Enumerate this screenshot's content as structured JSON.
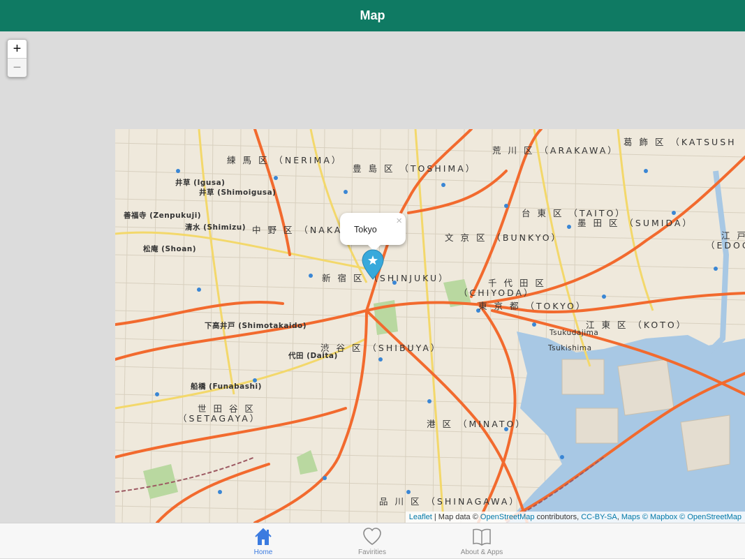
{
  "header": {
    "title": "Map"
  },
  "zoom": {
    "in_label": "+",
    "out_label": "−"
  },
  "map": {
    "popup_text": "Tokyo",
    "popup_close": "×",
    "labels": {
      "nerima": "練 馬 区 （NERIMA）",
      "toshima": "豊 島 区 （TOSHIMA）",
      "arakawa": "荒 川 区 （ARAKAWA）",
      "katsushika": "葛 飾 区 （KATSUSH",
      "igusa": "井草 (Igusa)",
      "shimoigusa": "井草 (Shimoigusa)",
      "zenpukuji": "善福寺 (Zenpukuji)",
      "shimizu": "清水 (Shimizu)",
      "nakano": "中 野 区 （NAKA",
      "taito": "台 東 区 （TAITO）",
      "sumida": "墨 田 区 （SUMIDA）",
      "edo": "江 戸",
      "edo2": "（EDOG",
      "bunkyo": "文 京 区 （BUNKYO）",
      "shoan": "松庵 (Shoan)",
      "shinjuku": "新 宿 区 （SHINJUKU）",
      "chiyoda_jp": "千 代 田 区",
      "chiyoda": "（CHIYODA）",
      "tokyo_ku": "東 京 都 （TOKYO）",
      "shimotakaido": "下高井戸 (Shimotakaido)",
      "koto": "江 東 区 （KOTO）",
      "tsukudajima": "Tsukudajima",
      "tsukishima": "Tsukishima",
      "shibuya": "渋 谷 区 （SHIBUYA）",
      "daita": "代田 (Daita)",
      "funabashi": "船橋 (Funabashi)",
      "setagaya_jp": "世 田 谷 区",
      "setagaya": "（SETAGAYA）",
      "minato": "港 区 （MINATO）",
      "shinagawa": "品 川 区 （SHINAGAWA）"
    },
    "attribution": {
      "leaflet": "Leaflet",
      "text1": " | Map data © ",
      "osm": "OpenStreetMap",
      "text2": " contributors, ",
      "ccbysa": "CC-BY-SA",
      "text3": ", ",
      "maps": "Maps © Mapbox © OpenStreetMap"
    }
  },
  "tabs": [
    {
      "label": "Home",
      "active": true,
      "icon": "house-icon"
    },
    {
      "label": "Favirities",
      "active": false,
      "icon": "heart-icon"
    },
    {
      "label": "About & Apps",
      "active": false,
      "icon": "book-icon"
    }
  ],
  "colors": {
    "header": "#0f7a63",
    "active_tab": "#3b7be0",
    "marker": "#38a9db",
    "road": "#f26a2e"
  }
}
